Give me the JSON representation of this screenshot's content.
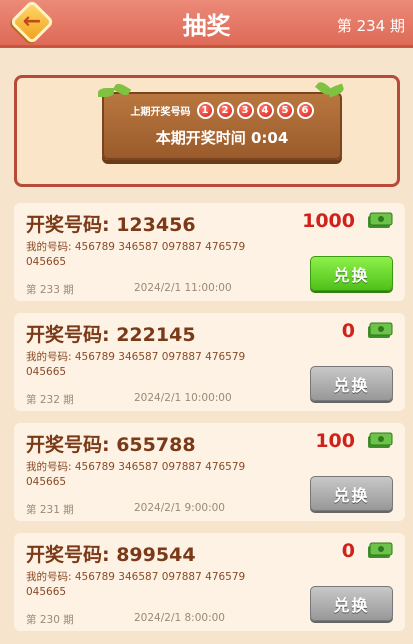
{
  "header": {
    "title": "抽奖",
    "period": "第 234 期"
  },
  "banner": {
    "last_label": "上期开奖号码",
    "balls": [
      "1",
      "2",
      "3",
      "4",
      "5",
      "6"
    ],
    "time_label": "本期开奖时间",
    "time_value": "0:04"
  },
  "cards": [
    {
      "code": "开奖号码: 123456",
      "amount": "1000",
      "mine": "我的号码: 456789 346587 097887 476579 045665",
      "period": "第 233 期",
      "time": "2024/2/1 11:00:00",
      "button": "兑换",
      "button_state": "active"
    },
    {
      "code": "开奖号码: 222145",
      "amount": "0",
      "mine": "我的号码: 456789 346587 097887 476579 045665",
      "period": "第 232 期",
      "time": "2024/2/1 10:00:00",
      "button": "兑换",
      "button_state": "disabled"
    },
    {
      "code": "开奖号码: 655788",
      "amount": "100",
      "mine": "我的号码: 456789 346587 097887 476579 045665",
      "period": "第 231 期",
      "time": "2024/2/1 9:00:00",
      "button": "兑换",
      "button_state": "disabled"
    },
    {
      "code": "开奖号码: 899544",
      "amount": "0",
      "mine": "我的号码: 456789 346587 097887 476579 045665",
      "period": "第 230 期",
      "time": "2024/2/1 8:00:00",
      "button": "兑换",
      "button_state": "disabled"
    }
  ],
  "icons": {
    "back": "back-arrow-icon",
    "cash": "cash-icon"
  },
  "colors": {
    "header": "#de6a57",
    "amount": "#d0221c",
    "active_button": "#4fc11a",
    "disabled_button": "#989898"
  }
}
